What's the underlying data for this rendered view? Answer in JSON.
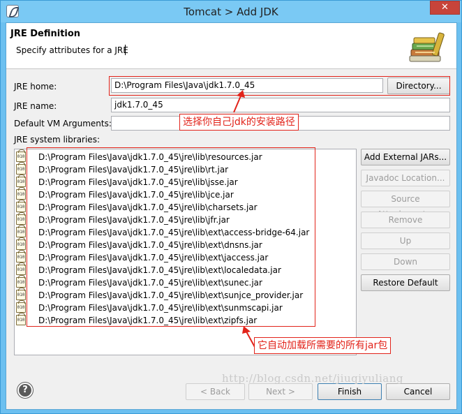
{
  "window": {
    "title": "Tomcat > Add JDK",
    "close_glyph": "✕"
  },
  "header": {
    "title": "JRE Definition",
    "subtitle": "Specify attributes for a JRE",
    "icon": "books-library-icon"
  },
  "form": {
    "jre_home_label": "JRE home:",
    "jre_home_value": "D:\\Program Files\\Java\\jdk1.7.0_45",
    "directory_button": "Directory...",
    "jre_name_label": "JRE name:",
    "jre_name_value": "jdk1.7.0_45",
    "vm_args_label": "Default VM Arguments:",
    "vm_args_value": "",
    "libraries_label": "JRE system libraries:"
  },
  "libraries": [
    "D:\\Program Files\\Java\\jdk1.7.0_45\\jre\\lib\\resources.jar",
    "D:\\Program Files\\Java\\jdk1.7.0_45\\jre\\lib\\rt.jar",
    "D:\\Program Files\\Java\\jdk1.7.0_45\\jre\\lib\\jsse.jar",
    "D:\\Program Files\\Java\\jdk1.7.0_45\\jre\\lib\\jce.jar",
    "D:\\Program Files\\Java\\jdk1.7.0_45\\jre\\lib\\charsets.jar",
    "D:\\Program Files\\Java\\jdk1.7.0_45\\jre\\lib\\jfr.jar",
    "D:\\Program Files\\Java\\jdk1.7.0_45\\jre\\lib\\ext\\access-bridge-64.jar",
    "D:\\Program Files\\Java\\jdk1.7.0_45\\jre\\lib\\ext\\dnsns.jar",
    "D:\\Program Files\\Java\\jdk1.7.0_45\\jre\\lib\\ext\\jaccess.jar",
    "D:\\Program Files\\Java\\jdk1.7.0_45\\jre\\lib\\ext\\localedata.jar",
    "D:\\Program Files\\Java\\jdk1.7.0_45\\jre\\lib\\ext\\sunec.jar",
    "D:\\Program Files\\Java\\jdk1.7.0_45\\jre\\lib\\ext\\sunjce_provider.jar",
    "D:\\Program Files\\Java\\jdk1.7.0_45\\jre\\lib\\ext\\sunmscapi.jar",
    "D:\\Program Files\\Java\\jdk1.7.0_45\\jre\\lib\\ext\\zipfs.jar"
  ],
  "side_buttons": {
    "add_external": "Add External JARs...",
    "javadoc": "Javadoc Location...",
    "source": "Source Attachment...",
    "remove": "Remove",
    "up": "Up",
    "down": "Down",
    "restore": "Restore Default"
  },
  "annotations": {
    "home_callout": "选择你自己jdk的安装路径",
    "libs_callout": "它自动加载所需要的所有jar包",
    "color": "#e2231a"
  },
  "footer": {
    "help": "?",
    "back": "< Back",
    "next": "Next >",
    "finish": "Finish",
    "cancel": "Cancel"
  },
  "watermark": "http://blog.csdn.net/jiuqiyuliang"
}
